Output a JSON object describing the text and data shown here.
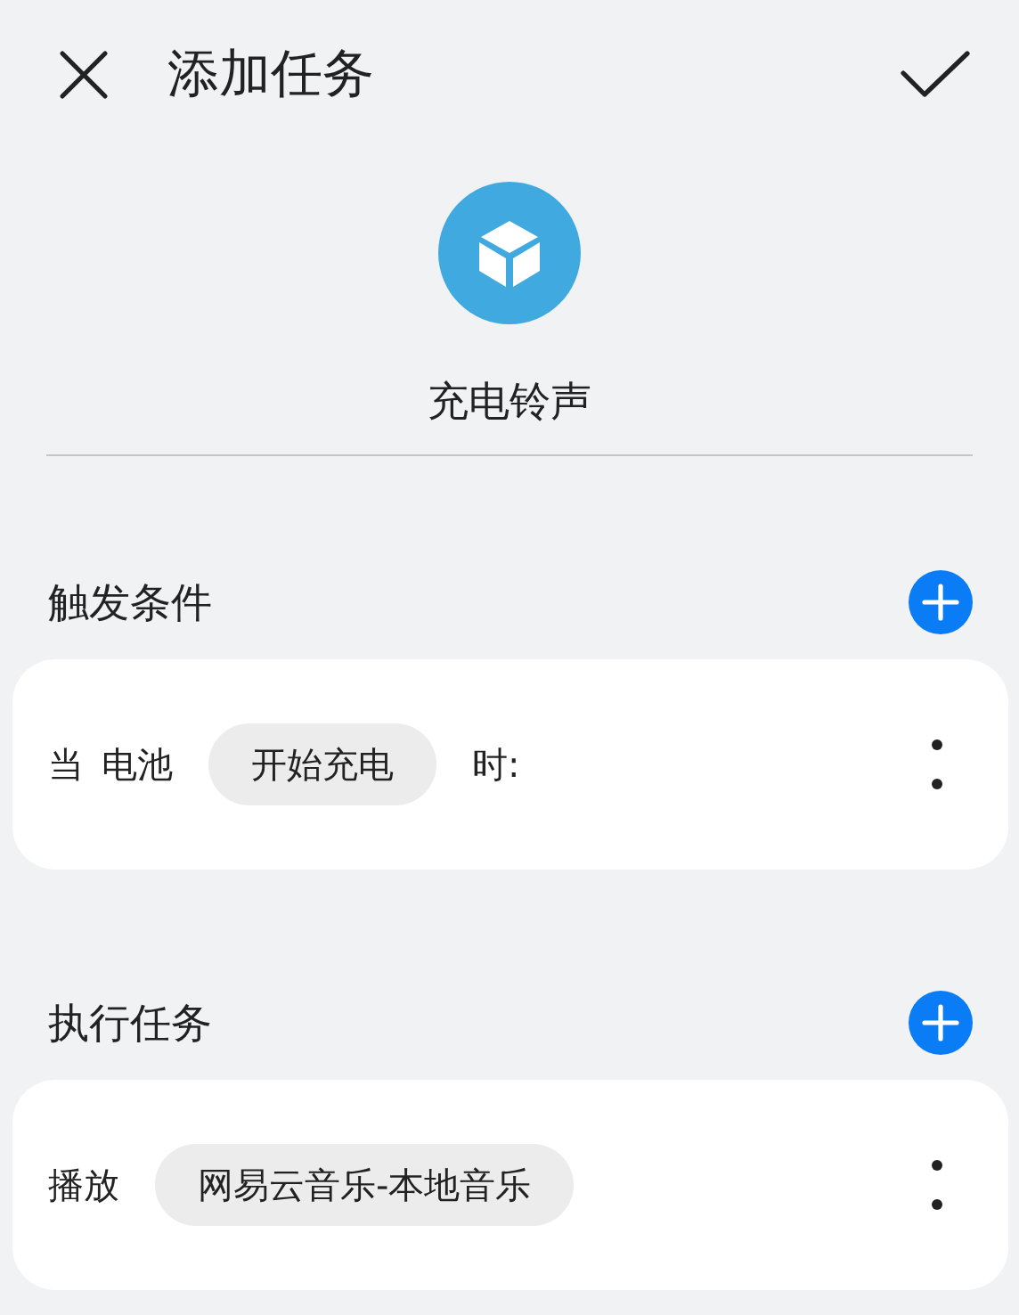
{
  "header": {
    "title": "添加任务"
  },
  "task": {
    "name": "充电铃声"
  },
  "sections": [
    {
      "title": "触发条件",
      "parts": [
        {
          "kind": "text",
          "text": "当"
        },
        {
          "kind": "text",
          "text": "电池"
        },
        {
          "kind": "chip",
          "text": "开始充电"
        },
        {
          "kind": "text",
          "text": "时:"
        }
      ]
    },
    {
      "title": "执行任务",
      "parts": [
        {
          "kind": "text",
          "text": "播放"
        },
        {
          "kind": "chip",
          "text": "网易云音乐-本地音乐"
        }
      ]
    }
  ]
}
